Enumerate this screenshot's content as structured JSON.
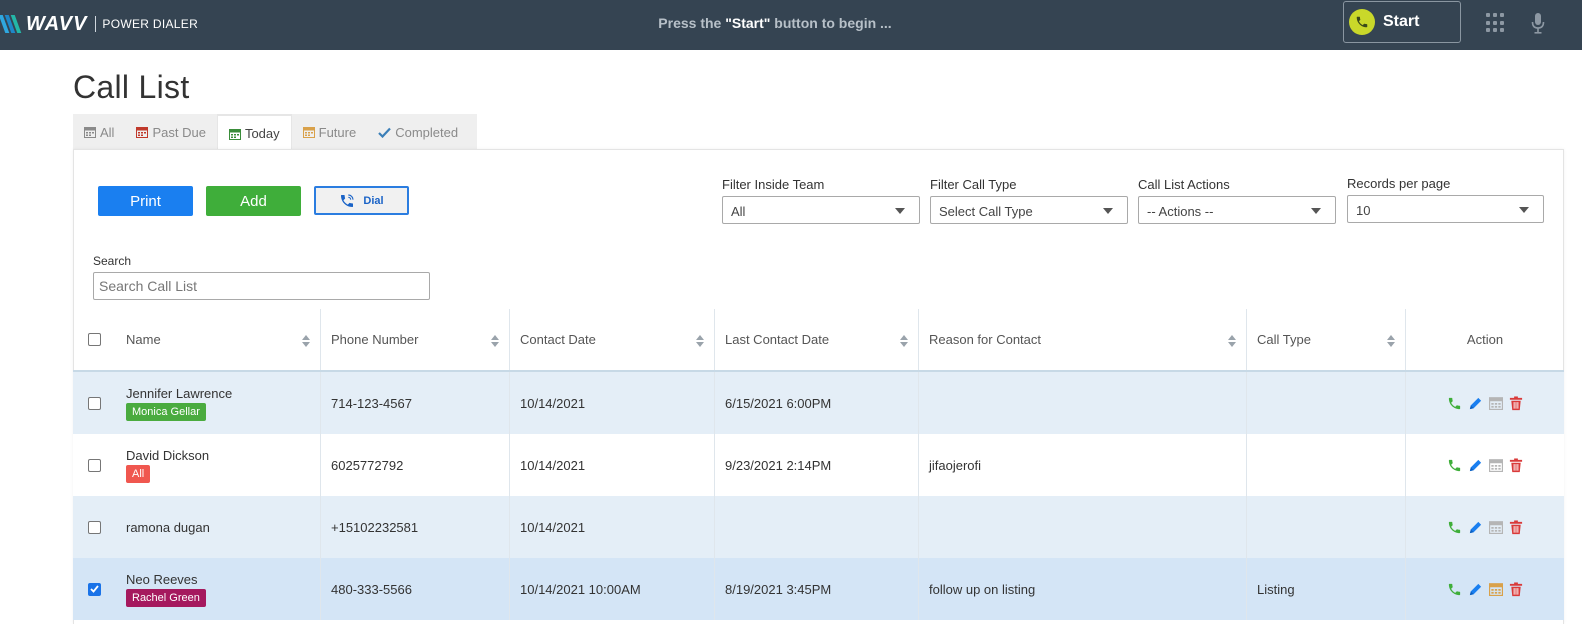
{
  "header": {
    "logo_word": "WAVV",
    "logo_sub": "POWER DIALER",
    "message_prefix": "Press the ",
    "message_bold": "\"Start\"",
    "message_suffix": " button to begin ...",
    "start_label": "Start"
  },
  "page": {
    "title": "Call List"
  },
  "tabs": [
    {
      "label": "All",
      "color": "#8a8a8a"
    },
    {
      "label": "Past Due",
      "color": "#c0392b"
    },
    {
      "label": "Today",
      "color": "#3a8d3a"
    },
    {
      "label": "Future",
      "color": "#d9a14a"
    },
    {
      "label": "Completed",
      "color": "#3b7fb8"
    }
  ],
  "toolbar": {
    "print": "Print",
    "add": "Add",
    "dial": "Dial"
  },
  "filters": {
    "team_label": "Filter Inside Team",
    "team_value": "All",
    "type_label": "Filter Call Type",
    "type_value": "Select Call Type",
    "actions_label": "Call List Actions",
    "actions_value": "-- Actions --",
    "records_label": "Records per page",
    "records_value": "10"
  },
  "search": {
    "label": "Search",
    "placeholder": "Search Call List"
  },
  "table": {
    "headers": [
      "Name",
      "Phone Number",
      "Contact Date",
      "Last Contact Date",
      "Reason for Contact",
      "Call Type",
      "Action"
    ],
    "rows": [
      {
        "name": "Jennifer Lawrence",
        "badge": "Monica Gellar",
        "badge_color": "#4aab3f",
        "phone": "714-123-4567",
        "contact_date": "10/14/2021",
        "last_contact": "6/15/2021 6:00PM",
        "reason": "",
        "call_type": "",
        "checked": false
      },
      {
        "name": "David Dickson",
        "badge": "All",
        "badge_color": "#f0574f",
        "phone": "6025772792",
        "contact_date": "10/14/2021",
        "last_contact": "9/23/2021 2:14PM",
        "reason": "jifaojerofi",
        "call_type": "",
        "checked": false
      },
      {
        "name": "ramona dugan",
        "badge": "",
        "badge_color": "",
        "phone": "+15102232581",
        "contact_date": "10/14/2021",
        "last_contact": "",
        "reason": "",
        "call_type": "",
        "checked": false
      },
      {
        "name": "Neo Reeves",
        "badge": "Rachel Green",
        "badge_color": "#a5195e",
        "phone": "480-333-5566",
        "contact_date": "10/14/2021 10:00AM",
        "last_contact": "8/19/2021 3:45PM",
        "reason": "follow up on listing",
        "call_type": "Listing",
        "checked": true
      }
    ]
  },
  "colors": {
    "topbar": "#354452",
    "primary": "#1a7ff0",
    "success": "#3fae3a",
    "start_accent": "#c9d82a"
  }
}
